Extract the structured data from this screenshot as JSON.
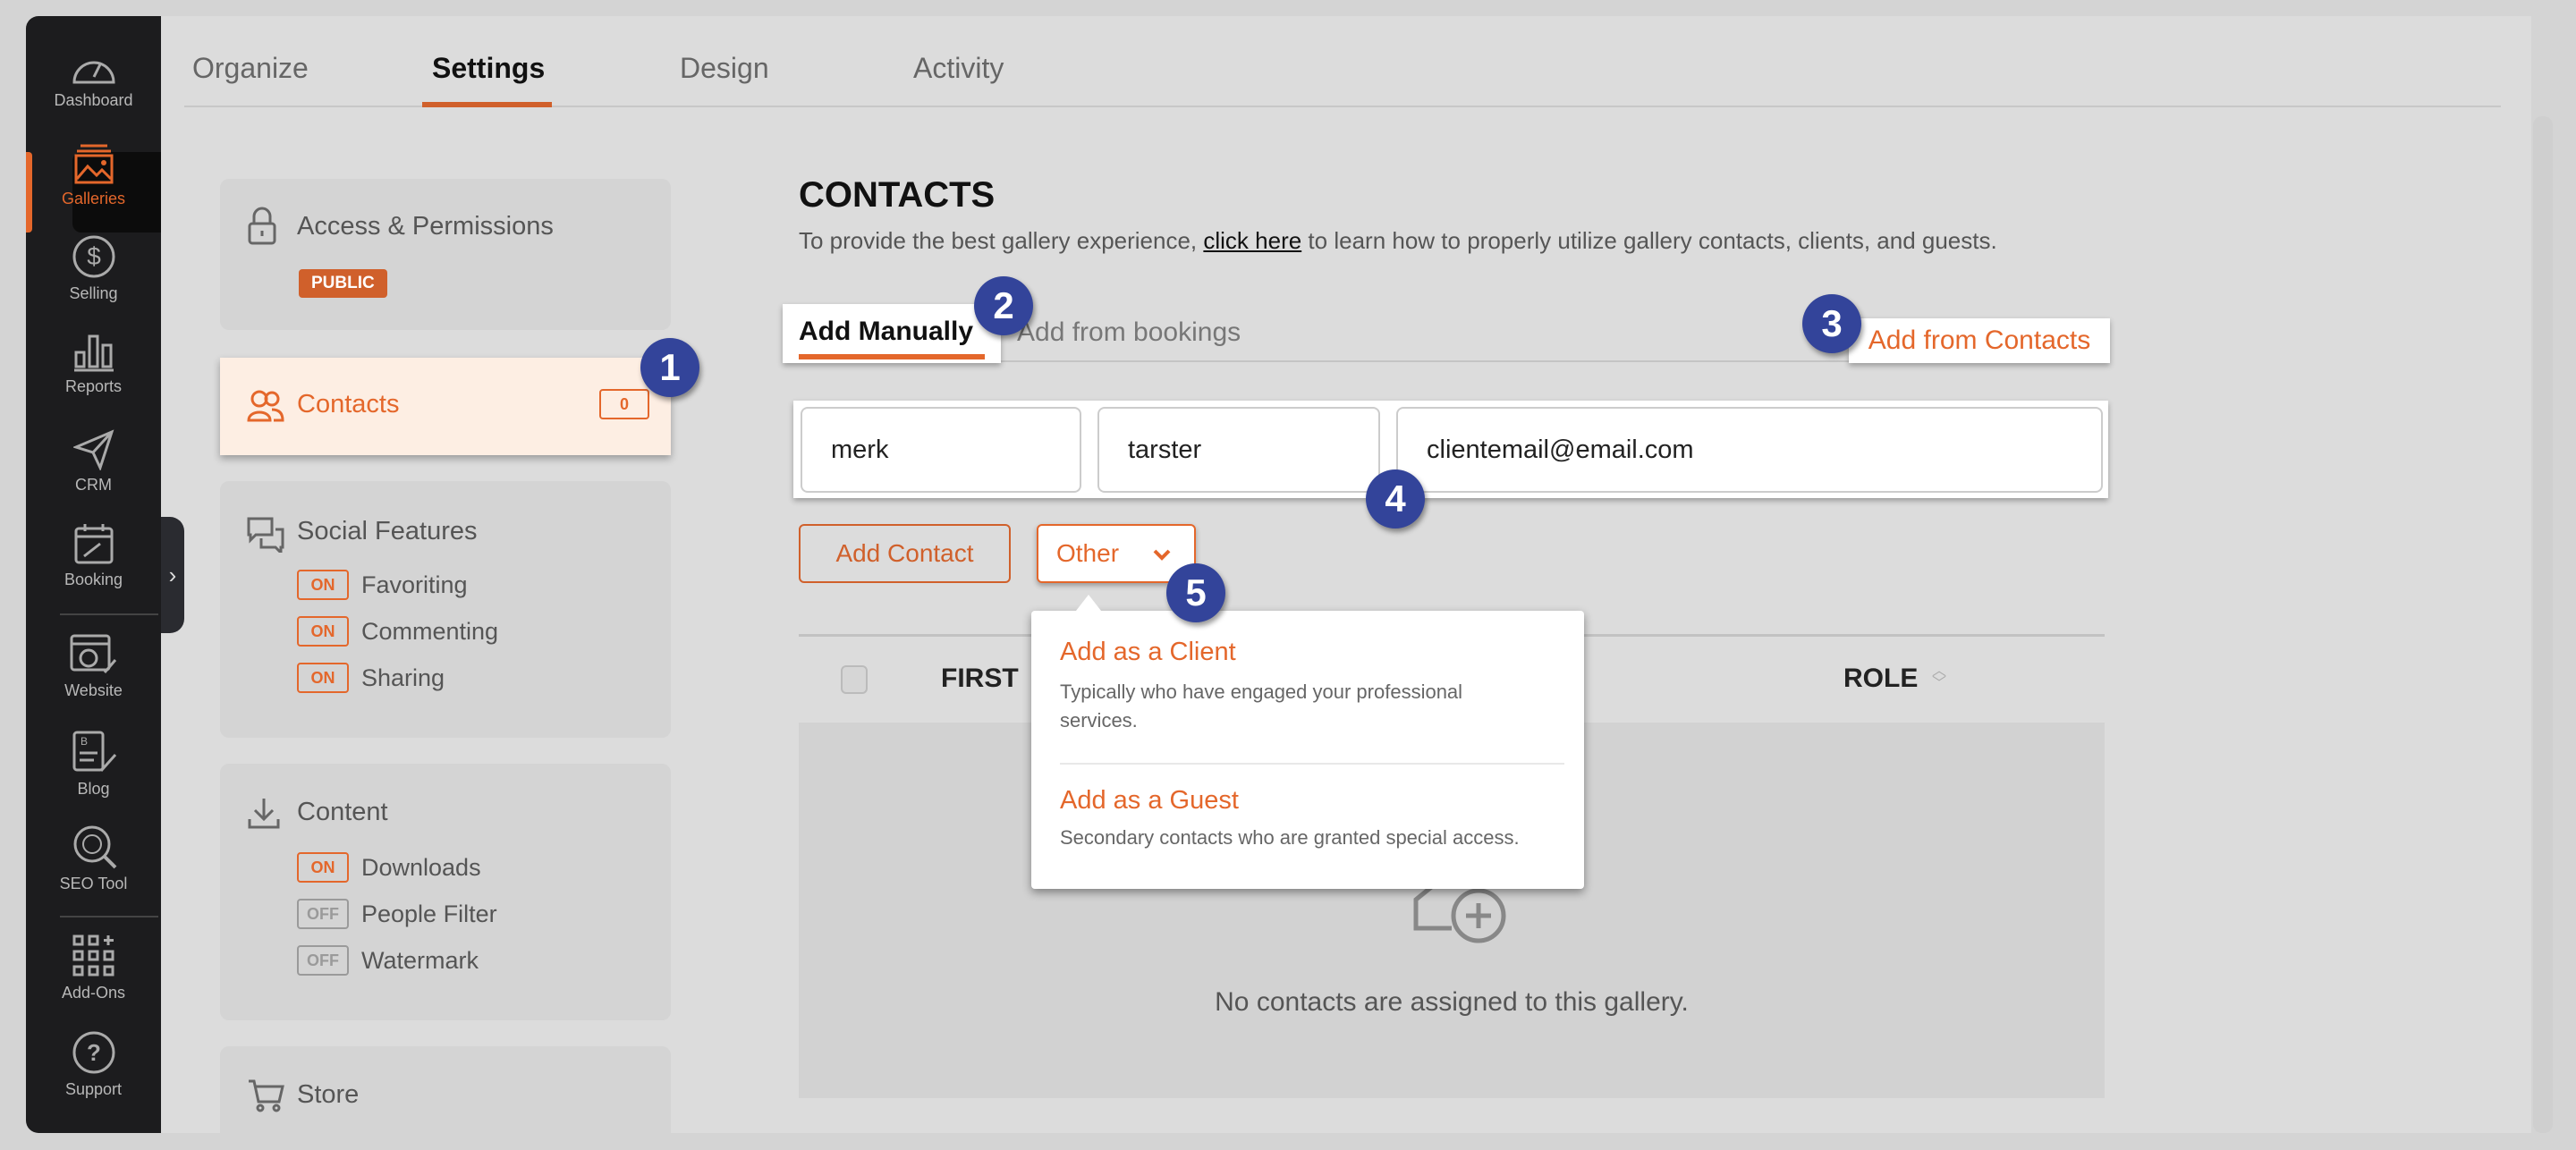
{
  "sidebar": {
    "items": [
      {
        "label": "Dashboard",
        "icon": "gauge-icon"
      },
      {
        "label": "Galleries",
        "icon": "image-icon",
        "active": true
      },
      {
        "label": "Selling",
        "icon": "dollar-icon"
      },
      {
        "label": "Reports",
        "icon": "bar-chart-icon"
      },
      {
        "label": "CRM",
        "icon": "paper-plane-icon"
      },
      {
        "label": "Booking",
        "icon": "calendar-icon"
      },
      {
        "label": "Website",
        "icon": "website-icon"
      },
      {
        "label": "Blog",
        "icon": "blog-icon"
      },
      {
        "label": "SEO Tool",
        "icon": "globe-search-icon"
      },
      {
        "label": "Add-Ons",
        "icon": "grid-plus-icon"
      },
      {
        "label": "Support",
        "icon": "question-icon"
      }
    ]
  },
  "tabs": [
    "Organize",
    "Settings",
    "Design",
    "Activity"
  ],
  "active_tab": "Settings",
  "settings_nav": {
    "access": {
      "title": "Access & Permissions",
      "badge": "PUBLIC"
    },
    "contacts": {
      "title": "Contacts",
      "count": "0"
    },
    "social": {
      "title": "Social Features",
      "toggles": [
        {
          "state": "ON",
          "label": "Favoriting"
        },
        {
          "state": "ON",
          "label": "Commenting"
        },
        {
          "state": "ON",
          "label": "Sharing"
        }
      ]
    },
    "content": {
      "title": "Content",
      "toggles": [
        {
          "state": "ON",
          "label": "Downloads"
        },
        {
          "state": "OFF",
          "label": "People Filter"
        },
        {
          "state": "OFF",
          "label": "Watermark"
        }
      ]
    },
    "store": {
      "title": "Store"
    }
  },
  "contacts": {
    "title": "CONTACTS",
    "desc_before": "To provide the best gallery experience, ",
    "desc_link": "click here",
    "desc_after": " to learn how to properly utilize gallery contacts, clients, and guests.",
    "subtabs": [
      "Add Manually",
      "Add from bookings"
    ],
    "add_from_contacts": "Add from Contacts",
    "first_name": "merk",
    "last_name": "tarster",
    "email": "clientemail@email.com",
    "add_contact": "Add Contact",
    "role_select": "Other",
    "table_headers": [
      "FIRST",
      "ROLE"
    ],
    "empty": "No contacts are assigned to this gallery.",
    "dropdown": [
      {
        "title": "Add as a Client",
        "desc": "Typically who have engaged your professional services."
      },
      {
        "title": "Add as a Guest",
        "desc": "Secondary contacts who are granted special access."
      }
    ]
  },
  "annotations": [
    "1",
    "2",
    "3",
    "4",
    "5"
  ],
  "colors": {
    "accent": "#e4672b",
    "sidebar": "#1c1c1e",
    "annotation": "#33449a",
    "selected_bg": "#fdeee3"
  }
}
